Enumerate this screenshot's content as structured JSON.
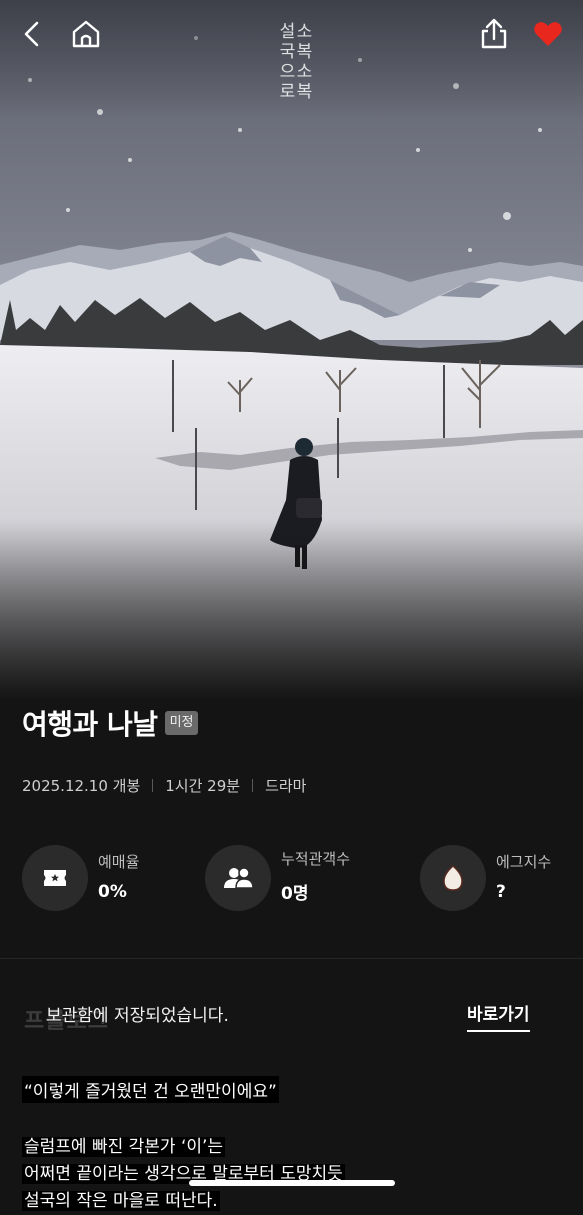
{
  "header": {
    "back": "back-icon",
    "home": "home-icon",
    "share": "share-icon",
    "like": "heart-icon",
    "like_color": "#e8281e"
  },
  "poster": {
    "vertical_lines": [
      "소복소복",
      "설국으로"
    ]
  },
  "movie": {
    "title": "여행과 나날",
    "rating_badge": "미정",
    "release": "2025.12.10 개봉",
    "runtime": "1시간 29분",
    "genre": "드라마"
  },
  "stats": [
    {
      "icon": "ticket-icon",
      "label": "예매율",
      "value": "0%"
    },
    {
      "icon": "people-icon",
      "label": "누적관객수",
      "value": "0명"
    },
    {
      "icon": "egg-icon",
      "label": "에그지수",
      "value": "?"
    }
  ],
  "prologue_heading": "프롤로그",
  "toast": {
    "message": "보관함에 저장되었습니다.",
    "action": "바로가기"
  },
  "synopsis": {
    "quote": "“이렇게 즐거웠던 건 오랜만이에요”",
    "lines": [
      "슬럼프에 빠진 각본가 ‘이’는",
      "어쩌면 끝이라는 생각으로 말로부터 도망치듯",
      "설국의 작은 마을로 떠난다."
    ]
  },
  "colors": {
    "background": "#141414",
    "accent_red": "#e8281e"
  }
}
